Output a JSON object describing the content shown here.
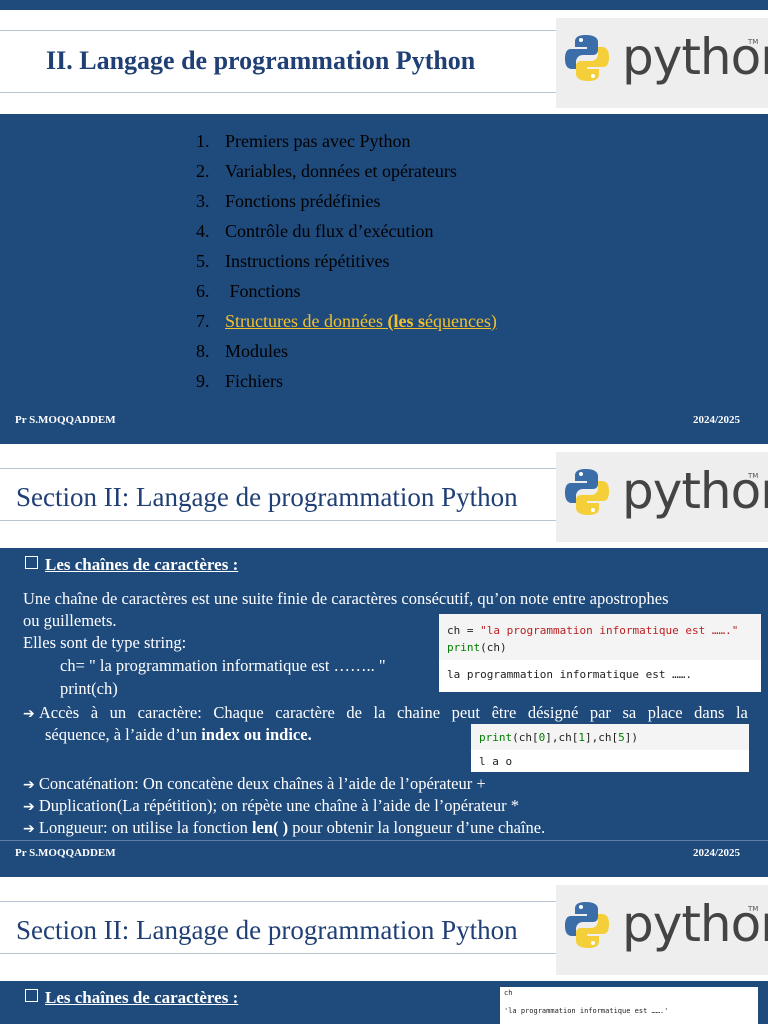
{
  "slide1": {
    "title": "II. Langage de programmation Python",
    "toc": [
      {
        "num": "1.",
        "label": "Premiers pas avec Python"
      },
      {
        "num": "2.",
        "label": "Variables, données et opérateurs"
      },
      {
        "num": "3.",
        "label": "Fonctions prédéfinies"
      },
      {
        "num": "4.",
        "label": "Contrôle du flux d’exécution"
      },
      {
        "num": "5.",
        "label": "Instructions répétitives"
      },
      {
        "num": "6.",
        "label": " Fonctions"
      },
      {
        "num": "7.",
        "label_a": "Structures de données ",
        "label_b": "(les s",
        "label_c": "équences) "
      },
      {
        "num": "8.",
        "label": "Modules"
      },
      {
        "num": "9.",
        "label": "Fichiers"
      }
    ],
    "footer_left": "Pr S.MOQQADDEM",
    "footer_right": "2024/2025"
  },
  "slide2": {
    "title": "Section II: Langage de programmation Python",
    "heading": "Les  chaînes de caractères :",
    "intro_1": "Une chaîne de caractères est une suite finie de caractères consécutif, qu’on note entre apostrophes",
    "intro_2": "ou guillemets.",
    "type_line": " Elles sont de type string:",
    "glyph": "",
    "example_1": "ch= \" la programmation informatique est …….. \"",
    "example_2": "print(ch)",
    "access_1": "Accès à un caractère: Chaque caractère de la chaine peut être désigné par sa place dans la",
    "access_2a": "séquence, à l’aide d’un ",
    "access_2b": "index ou indice.",
    "concat": "Concaténation: On concatène deux chaînes à l’aide  de l’opérateur +",
    "dup": "Duplication(La répétition); on répète une chaîne à l’aide de l’opérateur *",
    "len_a": "Longueur: on utilise la fonction ",
    "len_b": "len( )",
    "len_c": " pour obtenir la longueur d’une chaîne.",
    "code1": {
      "line1_var": "ch",
      "line1_eq": " = ",
      "line1_str": "\"la programmation informatique est …….\"",
      "line2_fn": "print",
      "line2_arg": "(ch)",
      "output": "la programmation informatique est ……."
    },
    "code2": {
      "fn": "print",
      "p1": "(ch[",
      "i0": "0",
      "p2": "],ch[",
      "i1": "1",
      "p3": "],ch[",
      "i2": "5",
      "p4": "])",
      "output": "l a o"
    },
    "footer_left": "Pr S.MOQQADDEM",
    "footer_right": "2024/2025"
  },
  "slide3": {
    "title": "Section II: Langage de programmation Python",
    "heading": "Les  chaînes de caractères :",
    "code_line1": "ch",
    "code_line2": "'la programmation informatique est …….'"
  },
  "logo": {
    "word": "python",
    "tm": "TM"
  },
  "colors": {
    "slide_bg": "#1f4a7c",
    "title": "#1f3f75",
    "highlight": "#f2c12e"
  }
}
